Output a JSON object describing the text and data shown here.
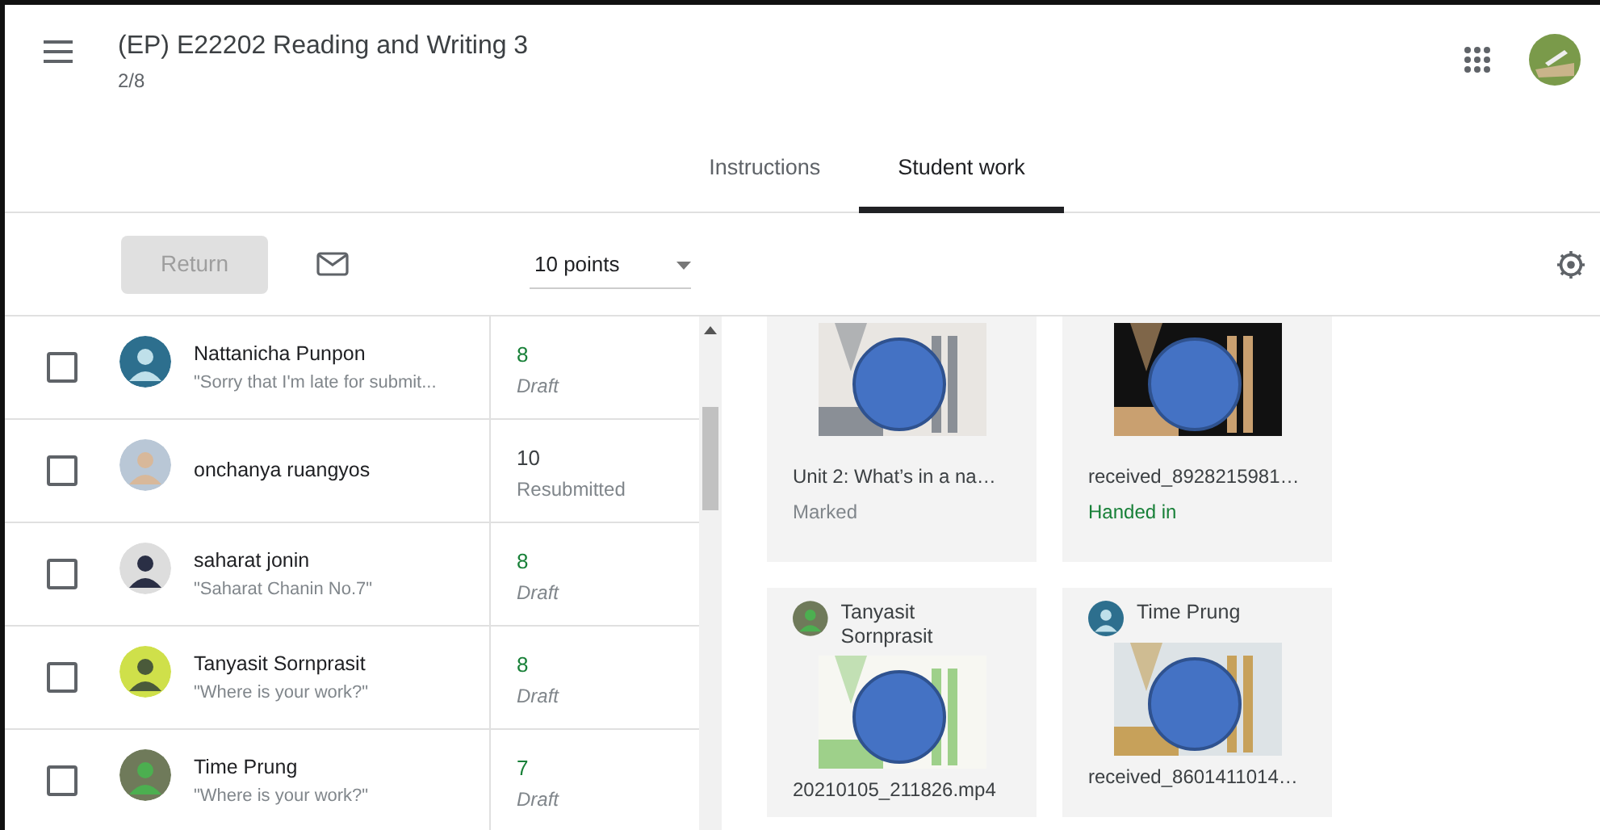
{
  "header": {
    "title": "(EP) E22202 Reading and Writing 3",
    "subtitle": "2/8"
  },
  "tabs": [
    {
      "label": "Instructions",
      "selected": false
    },
    {
      "label": "Student work",
      "selected": true
    }
  ],
  "toolbar": {
    "return_button": {
      "label": "Return",
      "disabled": true
    },
    "points": "10 points"
  },
  "students": [
    {
      "name": "Nattanicha Punpon",
      "comment": "\"Sorry that I'm late for submit...",
      "grade": "8",
      "status": "Draft",
      "kind": "draft",
      "checked": false
    },
    {
      "name": "onchanya ruangyos",
      "grade": "10",
      "status": "Resubmitted",
      "kind": "resubmitted",
      "checked": false
    },
    {
      "name": "saharat jonin",
      "comment": "\"Saharat Chanin No.7\"",
      "grade": "8",
      "status": "Draft",
      "kind": "draft",
      "checked": false
    },
    {
      "name": "Tanyasit Sornprasit",
      "comment": "\"Where is your work?\"",
      "grade": "8",
      "status": "Draft",
      "kind": "draft",
      "checked": false
    },
    {
      "name": "Time Prung",
      "comment": "\"Where is your work?\"",
      "grade": "7",
      "status": "Draft",
      "kind": "draft",
      "checked": false
    }
  ],
  "cards": [
    {
      "file": "Unit 2: What’s in a na…",
      "status": "Marked",
      "kind": "marked"
    },
    {
      "file": "received_8928215981…",
      "status": "Handed in",
      "kind": "handed_in"
    },
    {
      "author": "Tanyasit Sornprasit",
      "file": "20210105_211826.mp4"
    },
    {
      "author": "Time Prung",
      "file": "received_8601411014…"
    }
  ]
}
